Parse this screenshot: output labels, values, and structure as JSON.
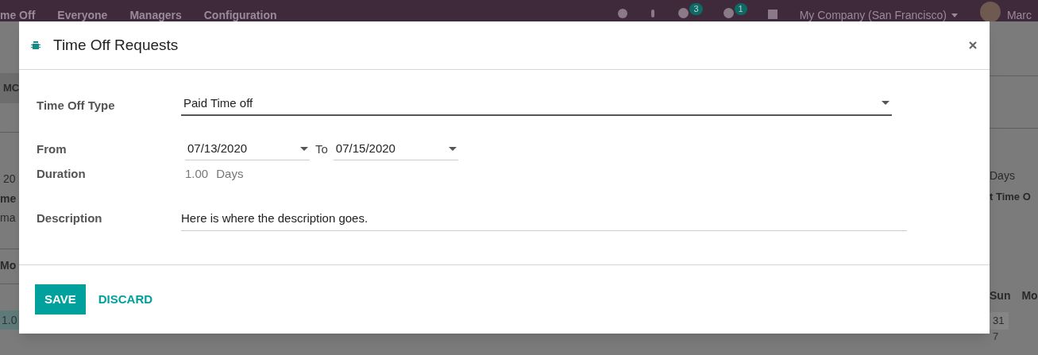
{
  "navbar": {
    "menu": [
      "me Off",
      "Everyone",
      "Managers",
      "Configuration"
    ],
    "badges": [
      {
        "count": "3"
      },
      {
        "count": "1"
      }
    ],
    "company": "My Company (San Francisco)",
    "user": "Marc"
  },
  "background": {
    "left": {
      "tab": "MC",
      "date": "20",
      "name": "me",
      "sub": "ma",
      "day": "Mo",
      "value": "1.0"
    },
    "right": {
      "days": "Days",
      "type": "t Time O",
      "weekdays": [
        "Sun",
        "Mo"
      ],
      "dates": [
        "31",
        "7"
      ]
    }
  },
  "dialog": {
    "title": "Time Off Requests",
    "type_label": "Time Off Type",
    "type_value": "Paid Time off",
    "from_label": "From",
    "from_date": "07/13/2020",
    "to_label": "To",
    "to_date": "07/15/2020",
    "duration_label": "Duration",
    "duration_value": "1.00",
    "duration_unit": "Days",
    "description_label": "Description",
    "description_value": "Here is where the description goes.",
    "buttons": [
      {
        "label": "SAVE",
        "kind": "primary"
      },
      {
        "label": "DISCARD",
        "kind": "link"
      }
    ]
  }
}
